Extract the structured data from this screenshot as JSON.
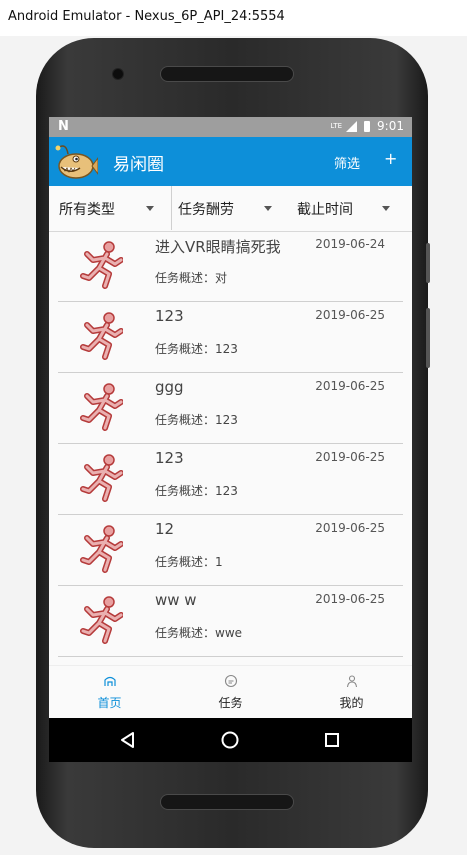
{
  "window": {
    "title": "Android Emulator - Nexus_6P_API_24:5554"
  },
  "status_bar": {
    "left_icon": "N",
    "network": "LTE",
    "time": "9:01"
  },
  "app_bar": {
    "title": "易闲圈",
    "filter_label": "筛选",
    "add_label": "+",
    "accent": "#0d8fd9"
  },
  "filters": [
    {
      "label": "所有类型"
    },
    {
      "label": "任务酬劳"
    },
    {
      "label": "截止时间"
    }
  ],
  "tasks": [
    {
      "title": "进入VR眼睛搞死我",
      "date": "2019-06-24",
      "desc": "任务概述：对"
    },
    {
      "title": "123",
      "date": "2019-06-25",
      "desc": "任务概述：123"
    },
    {
      "title": "ggg",
      "date": "2019-06-25",
      "desc": "任务概述：123"
    },
    {
      "title": "123",
      "date": "2019-06-25",
      "desc": "任务概述：123"
    },
    {
      "title": "12",
      "date": "2019-06-25",
      "desc": "任务概述：1"
    },
    {
      "title": "ww w",
      "date": "2019-06-25",
      "desc": "任务概述：wwe"
    },
    {
      "title": "",
      "date": "",
      "desc": ""
    }
  ],
  "bottom_nav": [
    {
      "label": "首页",
      "icon": "home-icon",
      "active": true
    },
    {
      "label": "任务",
      "icon": "chat-icon",
      "active": false
    },
    {
      "label": "我的",
      "icon": "person-icon",
      "active": false
    }
  ]
}
